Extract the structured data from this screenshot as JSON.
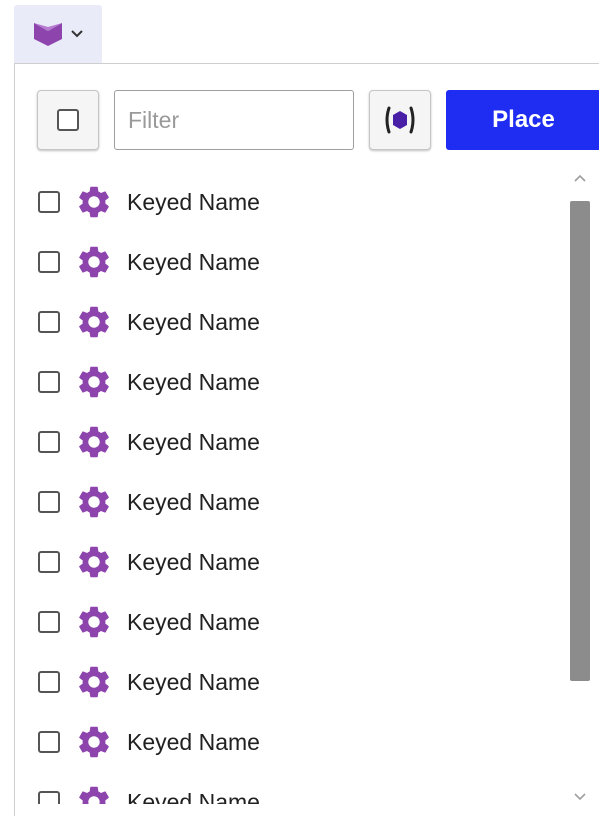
{
  "trigger": {
    "icon": "purple-chevron-box-icon",
    "caret": "chevron-down-icon"
  },
  "toolbar": {
    "filter_placeholder": "Filter",
    "filter_value": "",
    "type_icon": "purple-hexagon-icon",
    "place_label": "Place"
  },
  "list": {
    "item_icon": "gear-icon",
    "icon_color": "#8e44ad",
    "items": [
      {
        "label": "Keyed Name",
        "checked": false
      },
      {
        "label": "Keyed Name",
        "checked": false
      },
      {
        "label": "Keyed Name",
        "checked": false
      },
      {
        "label": "Keyed Name",
        "checked": false
      },
      {
        "label": "Keyed Name",
        "checked": false
      },
      {
        "label": "Keyed Name",
        "checked": false
      },
      {
        "label": "Keyed Name",
        "checked": false
      },
      {
        "label": "Keyed Name",
        "checked": false
      },
      {
        "label": "Keyed Name",
        "checked": false
      },
      {
        "label": "Keyed Name",
        "checked": false
      },
      {
        "label": "Keyed Name",
        "checked": false
      }
    ]
  },
  "colors": {
    "accent": "#1f2cf2",
    "purple": "#8e44ad",
    "trigger_bg": "#e9ecf8"
  }
}
